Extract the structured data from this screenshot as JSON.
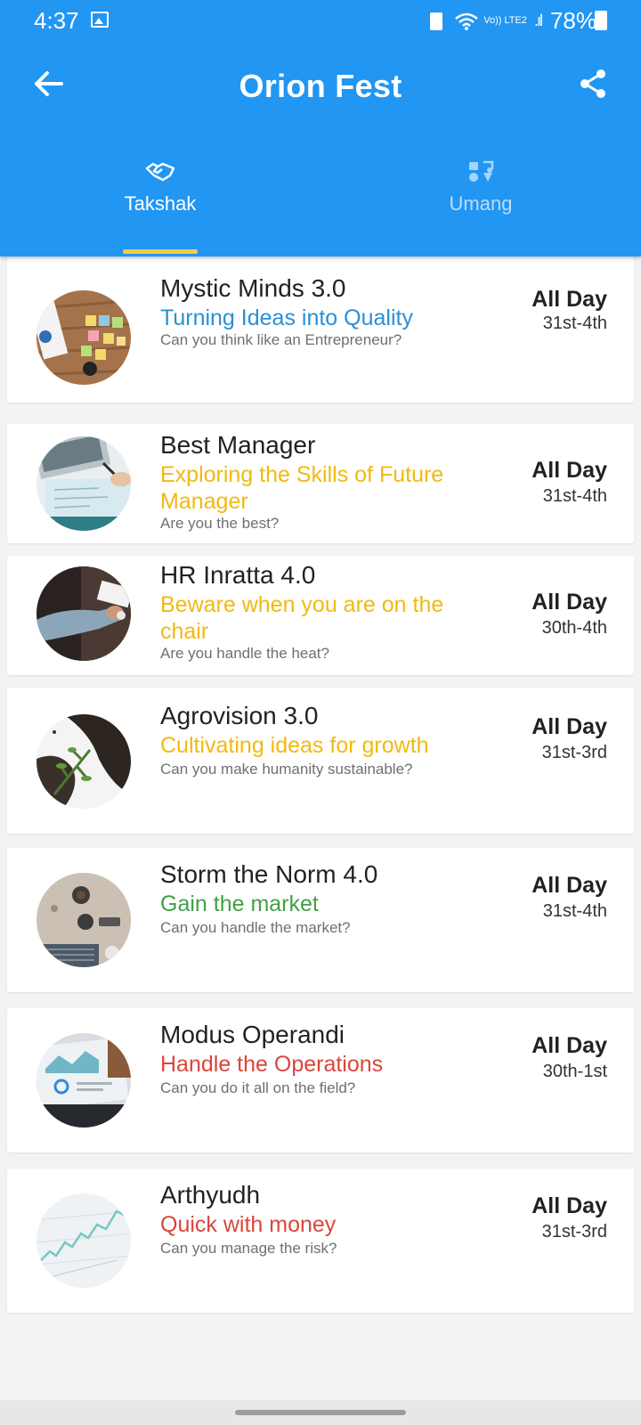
{
  "status_bar": {
    "time": "4:37",
    "network": "Vo)) LTE2",
    "battery": "78%"
  },
  "app": {
    "title": "Orion Fest",
    "accent_color": "#2196f3",
    "indicator_color": "#f7c948"
  },
  "tabs": [
    {
      "label": "Takshak",
      "icon": "handshake-icon",
      "selected": true
    },
    {
      "label": "Umang",
      "icon": "music-icon",
      "selected": false
    }
  ],
  "events": [
    {
      "title": "Mystic Minds 3.0",
      "tagline": "Turning Ideas into Quality",
      "tagline_color": "#2a8fd6",
      "question": "Can you think like an Entrepreneur?",
      "time": "All Day",
      "date": "31st-4th",
      "image": "sticky-notes-desk"
    },
    {
      "title": "Best Manager",
      "tagline": "Exploring the Skills of Future Manager",
      "tagline_color": "#f2b90f",
      "question": "Are you the best?",
      "time": "All Day",
      "date": "31st-4th",
      "image": "laptop-writing"
    },
    {
      "title": "HR Inratta 4.0",
      "tagline": "Beware when you are on the chair",
      "tagline_color": "#f2b90f",
      "question": "Are you handle the heat?",
      "time": "All Day",
      "date": "30th-4th",
      "image": "hands-on-desk"
    },
    {
      "title": "Agrovision 3.0",
      "tagline": "Cultivating ideas for growth",
      "tagline_color": "#f2b90f",
      "question": "Can you make humanity sustainable?",
      "time": "All Day",
      "date": "31st-3rd",
      "image": "plant-soil"
    },
    {
      "title": "Storm the Norm 4.0",
      "tagline": "Gain the market",
      "tagline_color": "#43a047",
      "question": "Can you handle the market?",
      "time": "All Day",
      "date": "31st-4th",
      "image": "coffee-table"
    },
    {
      "title": "Modus Operandi",
      "tagline": "Handle the Operations",
      "tagline_color": "#d9463b",
      "question": "Can you do it all on the field?",
      "time": "All Day",
      "date": "30th-1st",
      "image": "laptop-dashboard"
    },
    {
      "title": "Arthyudh",
      "tagline": "Quick with money",
      "tagline_color": "#d9463b",
      "question": "Can you manage the risk?",
      "time": "All Day",
      "date": "31st-3rd",
      "image": "stock-chart-paper"
    }
  ]
}
